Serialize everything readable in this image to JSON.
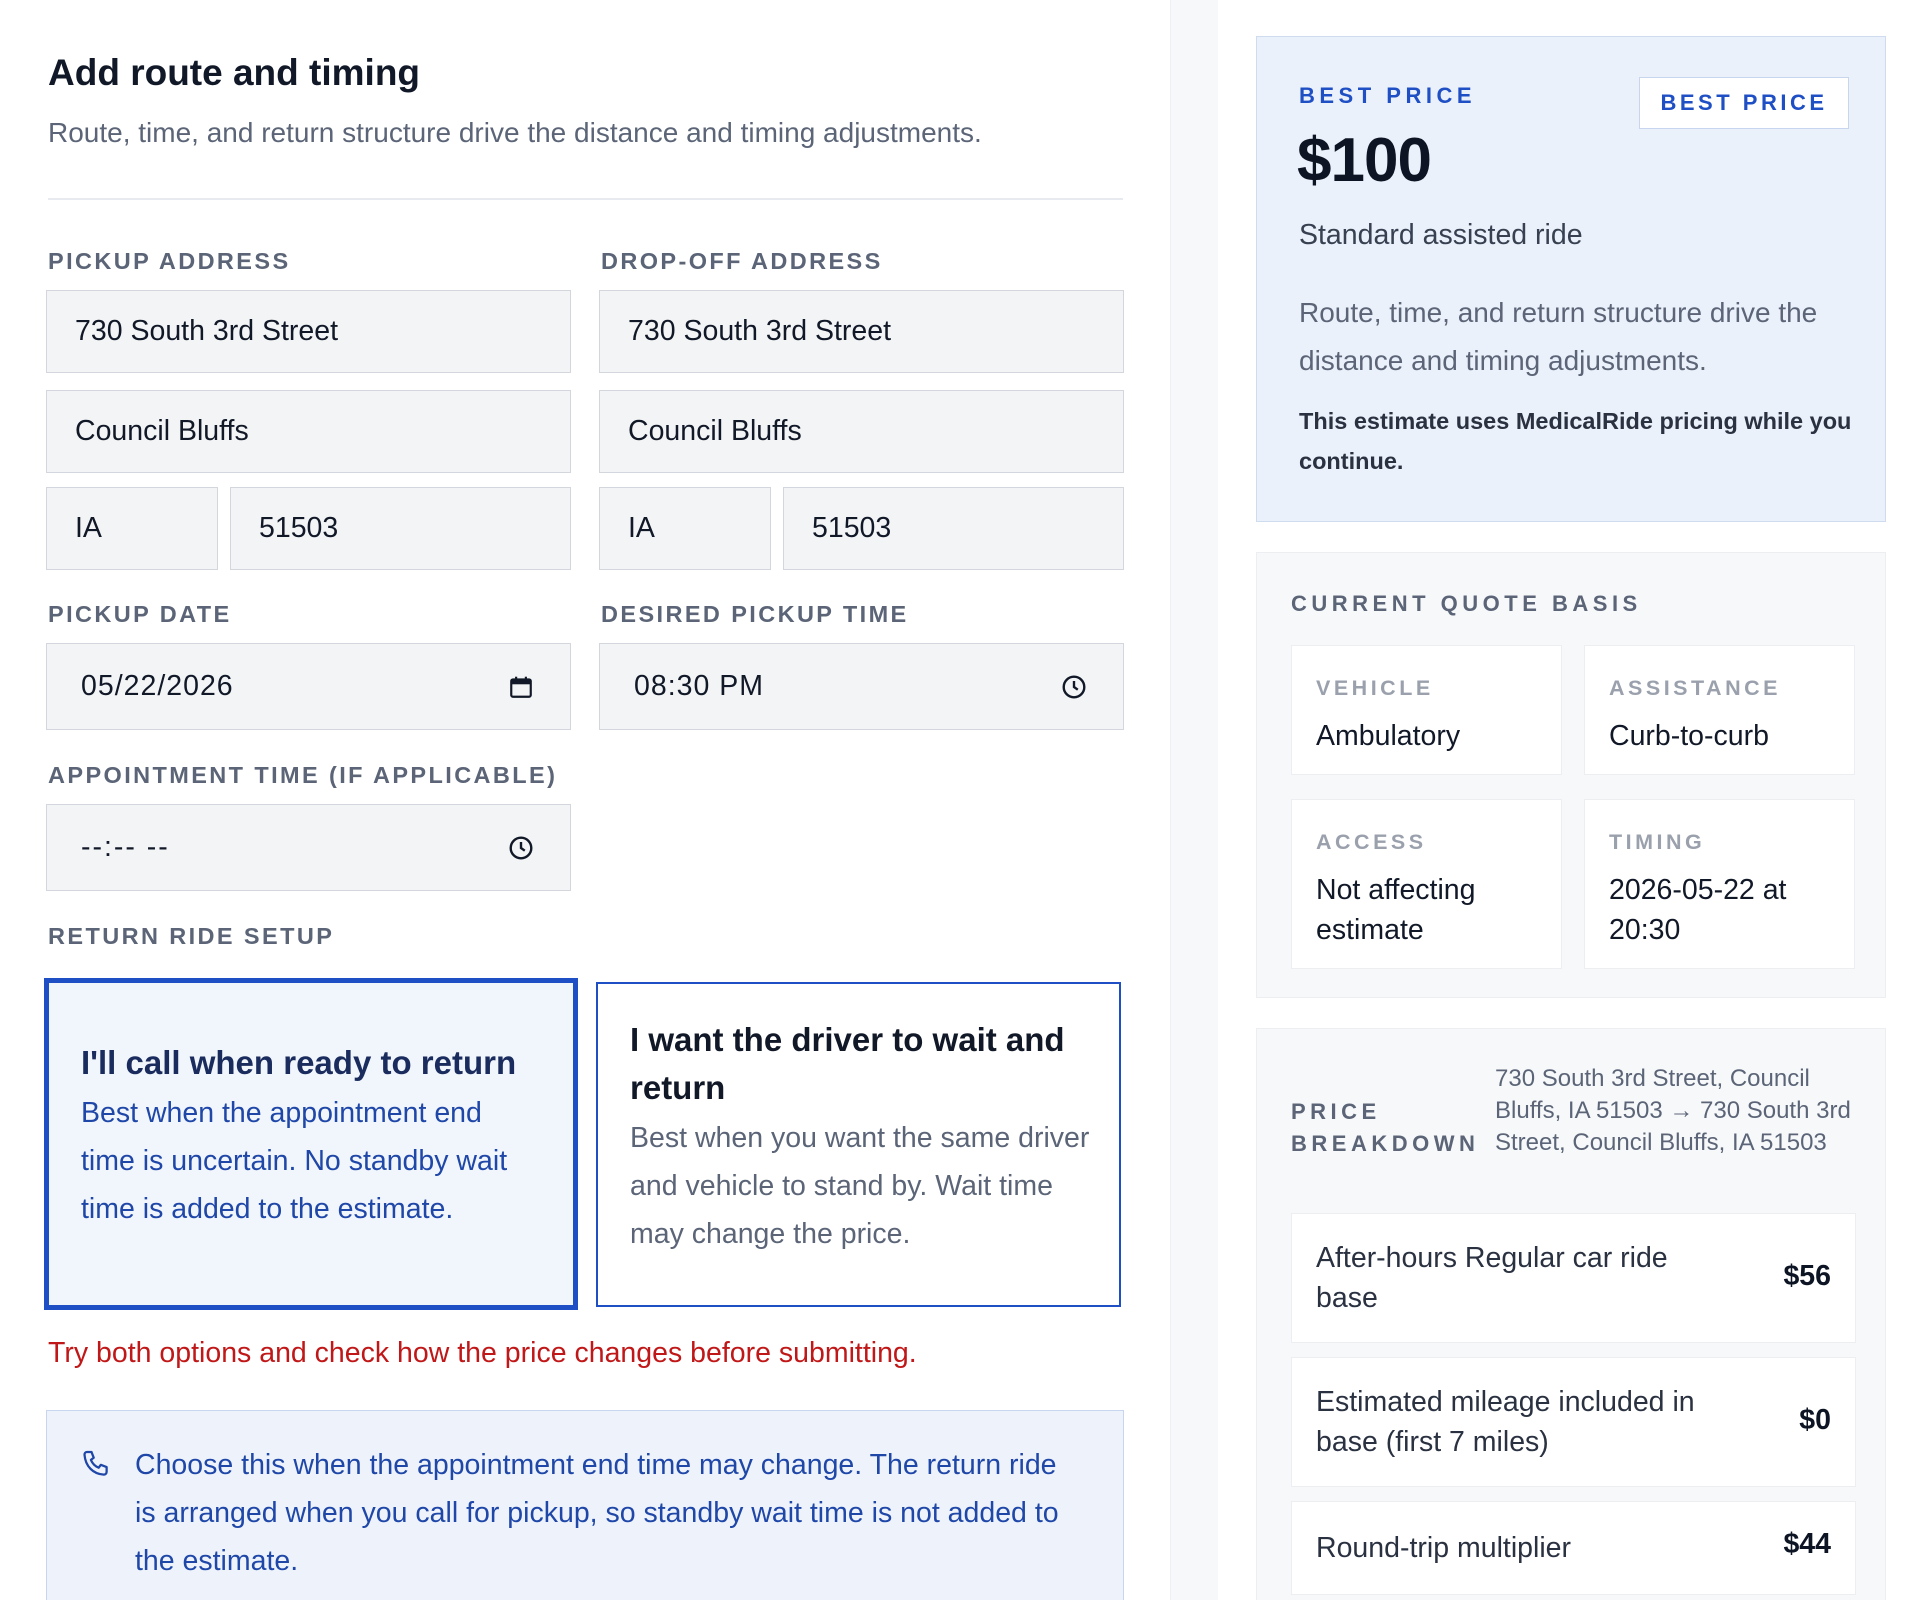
{
  "form": {
    "title": "Add route and timing",
    "subtitle": "Route, time, and return structure drive the distance and timing adjustments.",
    "pickup": {
      "label": "PICKUP ADDRESS",
      "street": "730 South 3rd Street",
      "city": "Council Bluffs",
      "state": "IA",
      "zip": "51503"
    },
    "dropoff": {
      "label": "DROP-OFF ADDRESS",
      "street": "730 South 3rd Street",
      "city": "Council Bluffs",
      "state": "IA",
      "zip": "51503"
    },
    "pickup_date": {
      "label": "PICKUP DATE",
      "value": "05/22/2026",
      "icon": "calendar-icon"
    },
    "pickup_time": {
      "label": "DESIRED PICKUP TIME",
      "value": "08:30 PM",
      "icon": "clock-icon"
    },
    "appointment_time": {
      "label": "APPOINTMENT TIME (IF APPLICABLE)",
      "value": "--:-- --",
      "icon": "clock-icon"
    },
    "return_setup": {
      "label": "RETURN RIDE SETUP",
      "options": [
        {
          "title": "I'll call when ready to return",
          "description": "Best when the appointment end time is uncertain. No standby wait time is added to the estimate.",
          "selected": true
        },
        {
          "title": "I want the driver to wait and return",
          "description": "Best when you want the same driver and vehicle to stand by. Wait time may change the price.",
          "selected": false
        }
      ]
    },
    "warning": "Try both options and check how the price changes before submitting.",
    "note": {
      "icon": "phone-icon",
      "text": "Choose this when the appointment end time may change. The return ride is arranged when you call for pickup, so standby wait time is not added to the estimate."
    }
  },
  "summary": {
    "price_card": {
      "eyebrow": "BEST PRICE",
      "badge": "BEST PRICE",
      "amount": "$100",
      "service": "Standard assisted ride",
      "description": "Route, time, and return structure drive the distance and timing adjustments.",
      "note": "This estimate uses MedicalRide pricing while you continue."
    },
    "quote_basis": {
      "eyebrow": "CURRENT QUOTE BASIS",
      "tiles": [
        {
          "label": "VEHICLE",
          "value": "Ambulatory"
        },
        {
          "label": "ASSISTANCE",
          "value": "Curb-to-curb"
        },
        {
          "label": "ACCESS",
          "value": "Not affecting estimate"
        },
        {
          "label": "TIMING",
          "value": "2026-05-22 at 20:30"
        }
      ]
    },
    "breakdown": {
      "eyebrow": "PRICE BREAKDOWN",
      "route": "730 South 3rd Street, Council Bluffs, IA 51503 → 730 South 3rd Street, Council Bluffs, IA 51503",
      "items": [
        {
          "label": "After-hours Regular car ride base",
          "amount": "$56"
        },
        {
          "label": "Estimated mileage included in base (first 7 miles)",
          "amount": "$0"
        },
        {
          "label": "Round-trip multiplier",
          "amount": "$44"
        }
      ]
    }
  },
  "colors": {
    "accent": "#1f4fc4",
    "warning": "#c01818",
    "muted_text": "#5b6577",
    "panel_bg": "#ebf1fa"
  }
}
